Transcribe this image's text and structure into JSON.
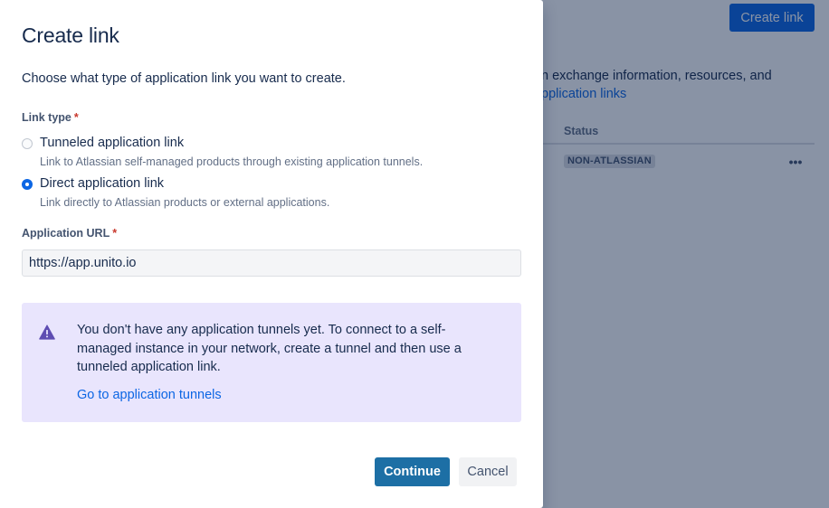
{
  "background": {
    "create_link_label": "Create link",
    "description_line1": "n exchange information, resources, and",
    "description_line2": "pplication links",
    "table": {
      "status_header": "Status",
      "rows": [
        {
          "status": "NON-ATLASSIAN",
          "actions_icon": "more-icon"
        }
      ]
    }
  },
  "modal": {
    "title": "Create link",
    "intro": "Choose what type of application link you want to create.",
    "link_type": {
      "label": "Link type",
      "required_marker": "*",
      "options": [
        {
          "label": "Tunneled application link",
          "help": "Link to Atlassian self-managed products through existing application tunnels.",
          "selected": false
        },
        {
          "label": "Direct application link",
          "help": "Link directly to Atlassian products or external applications.",
          "selected": true
        }
      ]
    },
    "application_url": {
      "label": "Application URL",
      "required_marker": "*",
      "value": "https://app.unito.io"
    },
    "notice": {
      "icon": "warning-icon",
      "text": "You don't have any application tunnels yet. To connect to a self-managed instance in your network, create a tunnel and then use a tunneled application link.",
      "link_label": "Go to application tunnels"
    },
    "footer": {
      "continue_label": "Continue",
      "cancel_label": "Cancel"
    }
  },
  "colors": {
    "primary": "#0c66e4",
    "continue_button": "#1d6fa5",
    "notice_background": "#e9e5fd",
    "notice_icon": "#5e4db2",
    "required": "#c9372c",
    "overlay": "rgba(9, 30, 66, 0.48)"
  }
}
